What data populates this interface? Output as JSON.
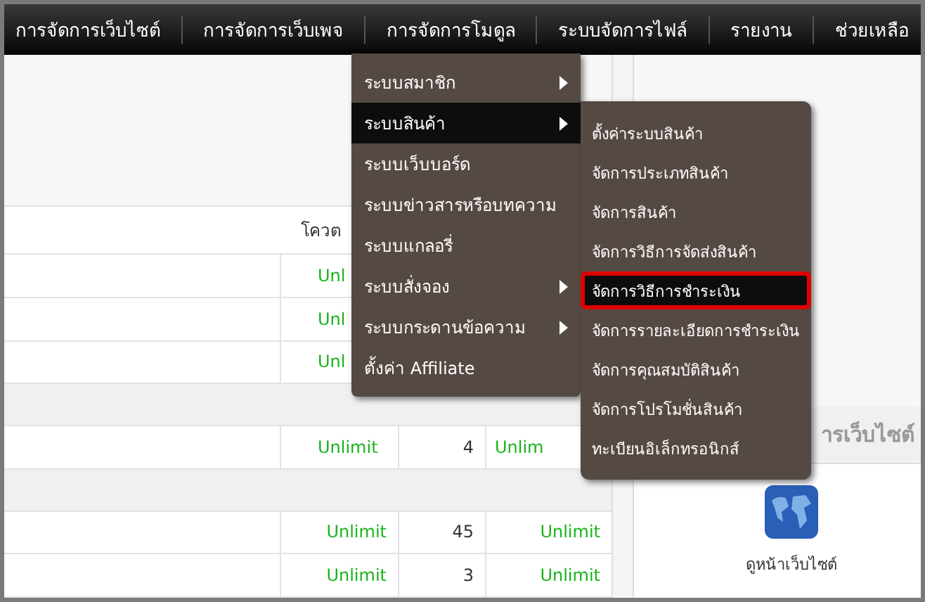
{
  "nav": [
    {
      "label": "การจัดการเว็บไซต์"
    },
    {
      "label": "การจัดการเว็บเพจ"
    },
    {
      "label": "การจัดการโมดูล"
    },
    {
      "label": "ระบบจัดการไฟล์"
    },
    {
      "label": "รายงาน"
    },
    {
      "label": "ช่วยเหลือ"
    }
  ],
  "table": {
    "columns": [
      "โควต"
    ],
    "rows": [
      {
        "kind": "partial",
        "cells": [
          "Unl",
          "",
          ""
        ]
      },
      {
        "kind": "partial",
        "cells": [
          "Unl",
          "",
          ""
        ]
      },
      {
        "kind": "partial",
        "cells": [
          "Unl",
          "",
          ""
        ]
      },
      {
        "kind": "section"
      },
      {
        "kind": "partial",
        "cells": [
          "Unlimit",
          "4",
          "Unlim"
        ]
      },
      {
        "kind": "section"
      },
      {
        "kind": "data",
        "cells": [
          "Unlimit",
          "45",
          "Unlimit"
        ]
      },
      {
        "kind": "data",
        "cells": [
          "Unlimit",
          "3",
          "Unlimit"
        ]
      }
    ]
  },
  "side_panel": {
    "heading": "ารเว็บไซต์",
    "shortcut": "ดูหน้าเว็บไซต์"
  },
  "menu": [
    {
      "label": "ระบบสมาชิก",
      "has_submenu": true,
      "selected": false
    },
    {
      "label": "ระบบสินค้า",
      "has_submenu": true,
      "selected": true
    },
    {
      "label": "ระบบเว็บบอร์ด",
      "has_submenu": false,
      "selected": false
    },
    {
      "label": "ระบบข่าวสารหรือบทความ",
      "has_submenu": false,
      "selected": false
    },
    {
      "label": "ระบบแกลอรี่",
      "has_submenu": false,
      "selected": false
    },
    {
      "label": "ระบบสั่งจอง",
      "has_submenu": true,
      "selected": false
    },
    {
      "label": "ระบบกระดานข้อความ",
      "has_submenu": true,
      "selected": false
    },
    {
      "label": "ตั้งค่า Affiliate",
      "has_submenu": false,
      "selected": false
    }
  ],
  "submenu": [
    {
      "label": "ตั้งค่าระบบสินค้า",
      "selected": false
    },
    {
      "label": "จัดการประเภทสินค้า",
      "selected": false
    },
    {
      "label": "จัดการสินค้า",
      "selected": false
    },
    {
      "label": "จัดการวิธีการจัดส่งสินค้า",
      "selected": false
    },
    {
      "label": "จัดการวิธีการชำระเงิน",
      "selected": true
    },
    {
      "label": "จัดการรายละเอียดการชำระเงิน",
      "selected": false
    },
    {
      "label": "จัดการคุณสมบัติสินค้า",
      "selected": false
    },
    {
      "label": "จัดการโปรโมชั่นสินค้า",
      "selected": false
    },
    {
      "label": "ทะเบียนอิเล็กทรอนิกส์",
      "selected": false
    }
  ]
}
